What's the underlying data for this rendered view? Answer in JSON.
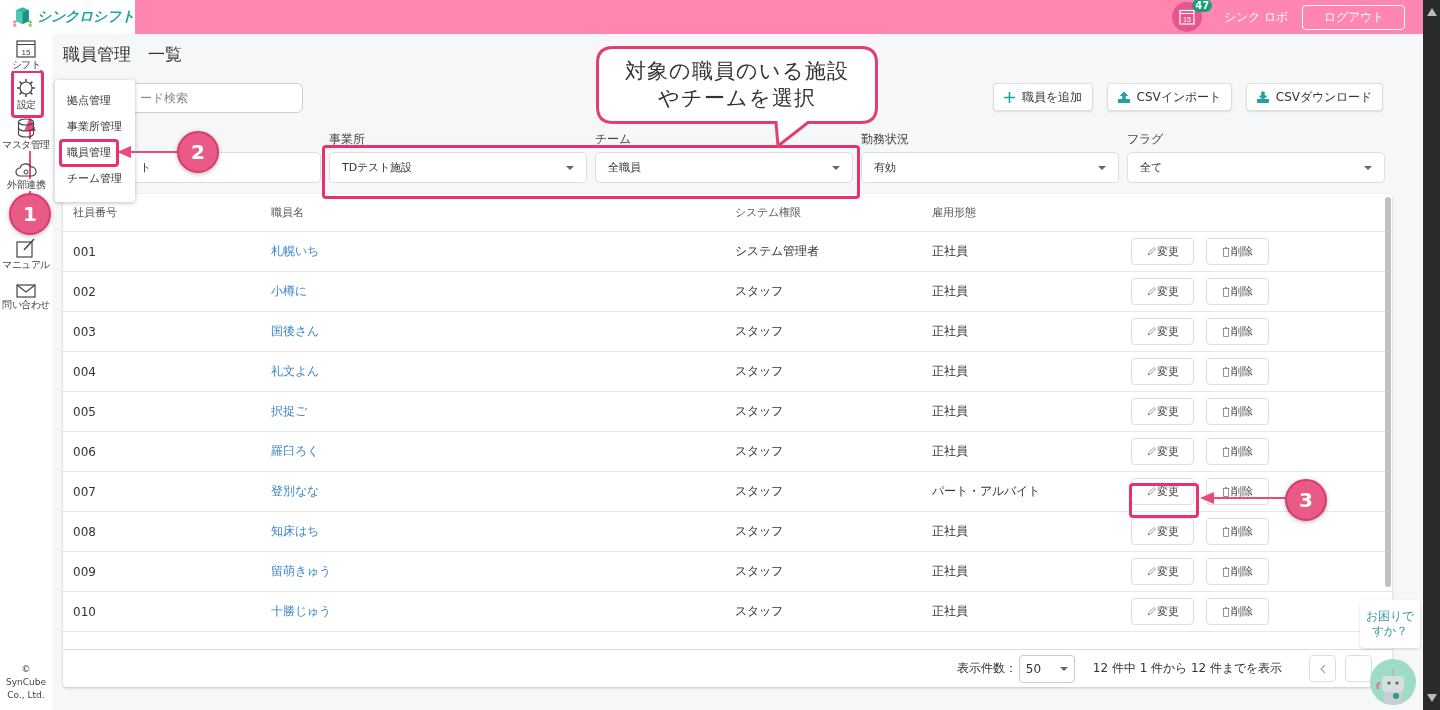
{
  "header": {
    "logo_text": "シンクロシフト",
    "calendar_day": "15",
    "notification_count": "47",
    "user_name": "シンク ロボ",
    "logout": "ログアウト"
  },
  "sidebar": {
    "items": [
      {
        "label": "シフト",
        "kind": "calendar",
        "icon_text": "15"
      },
      {
        "label": "設定",
        "kind": "gear"
      },
      {
        "label": "マスタ管理",
        "kind": "database"
      },
      {
        "label": "外部連携",
        "kind": "cloud"
      },
      {
        "label": "マニュアル",
        "kind": "note"
      },
      {
        "label": "問い合わせ",
        "kind": "mail"
      }
    ],
    "copyright": "© SynCube Co., Ltd."
  },
  "page_title": "職員管理　一覧",
  "search": {
    "placeholder": "ード検索"
  },
  "actions": [
    {
      "label": "職員を追加",
      "kind": "plus"
    },
    {
      "label": "CSVインポート",
      "kind": "upload"
    },
    {
      "label": "CSVダウンロード",
      "kind": "download"
    }
  ],
  "filters": [
    {
      "kind": "text",
      "value": "ト"
    },
    {
      "kind": "select",
      "label": "事業所",
      "value": "TDテスト施設"
    },
    {
      "kind": "select",
      "label": "チーム",
      "value": "全職員"
    },
    {
      "kind": "select",
      "label": "勤務状況",
      "value": "有効"
    },
    {
      "kind": "select",
      "label": "フラグ",
      "value": "全て"
    }
  ],
  "settings_menu": {
    "items": [
      "拠点管理",
      "事業所管理",
      "職員管理",
      "チーム管理"
    ]
  },
  "table": {
    "columns": [
      "社員番号",
      "職員名",
      "システム権限",
      "雇用形態"
    ],
    "rows": [
      {
        "id": "001",
        "name": "札幌いち",
        "role": "システム管理者",
        "employment": "正社員",
        "edit": "変更",
        "delete": "削除"
      },
      {
        "id": "002",
        "name": "小樽に",
        "role": "スタッフ",
        "employment": "正社員",
        "edit": "変更",
        "delete": "削除"
      },
      {
        "id": "003",
        "name": "国後さん",
        "role": "スタッフ",
        "employment": "正社員",
        "edit": "変更",
        "delete": "削除"
      },
      {
        "id": "004",
        "name": "礼文よん",
        "role": "スタッフ",
        "employment": "正社員",
        "edit": "変更",
        "delete": "削除"
      },
      {
        "id": "005",
        "name": "択捉ご",
        "role": "スタッフ",
        "employment": "正社員",
        "edit": "変更",
        "delete": "削除"
      },
      {
        "id": "006",
        "name": "羅臼ろく",
        "role": "スタッフ",
        "employment": "正社員",
        "edit": "変更",
        "delete": "削除"
      },
      {
        "id": "007",
        "name": "登別なな",
        "role": "スタッフ",
        "employment": "パート・アルバイト",
        "edit": "変更",
        "delete": "削除"
      },
      {
        "id": "008",
        "name": "知床はち",
        "role": "スタッフ",
        "employment": "正社員",
        "edit": "変更",
        "delete": "削除"
      },
      {
        "id": "009",
        "name": "留萌きゅう",
        "role": "スタッフ",
        "employment": "正社員",
        "edit": "変更",
        "delete": "削除"
      },
      {
        "id": "010",
        "name": "十勝じゅう",
        "role": "スタッフ",
        "employment": "正社員",
        "edit": "変更",
        "delete": "削除"
      }
    ]
  },
  "pagination": {
    "page_size_label": "表示件数：",
    "page_size": "50",
    "summary": "12 件中 1 件から 12 件までを表示"
  },
  "help_chat": {
    "lines": [
      "お困りで",
      "すか？"
    ]
  },
  "annotations": {
    "steps": [
      "1",
      "2",
      "3"
    ],
    "callout": [
      "対象の職員のいる施設",
      "やチームを選択"
    ]
  }
}
